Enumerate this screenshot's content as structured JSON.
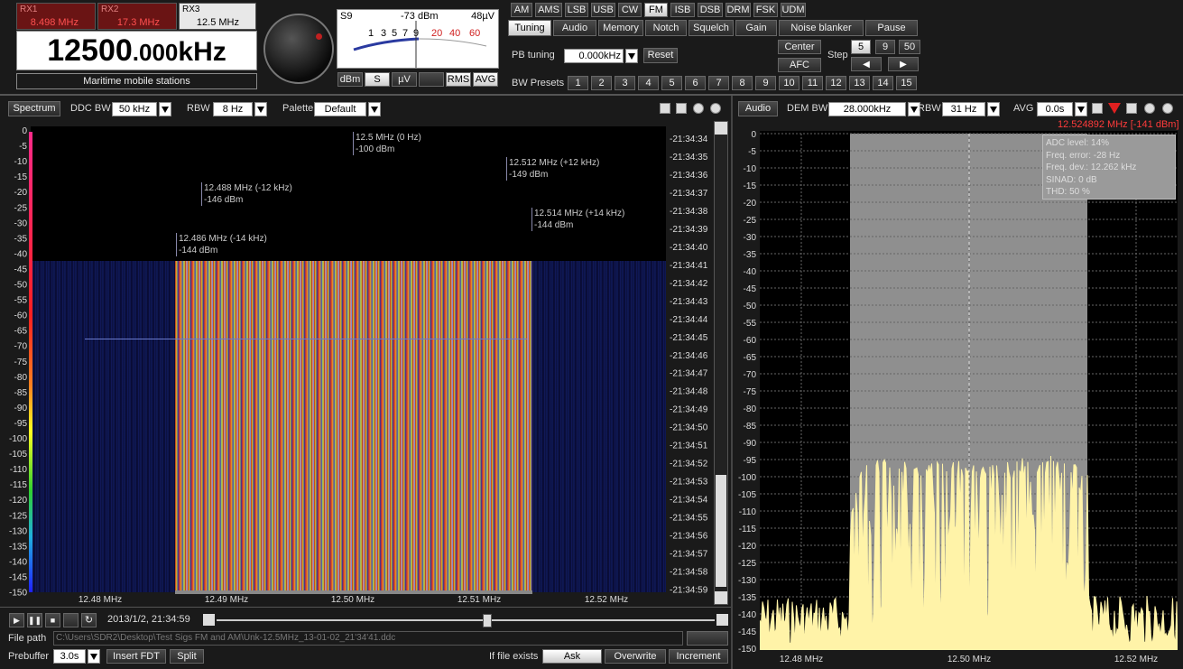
{
  "receivers": [
    {
      "name": "RX1",
      "freq": "8.498 MHz",
      "active": false
    },
    {
      "name": "RX2",
      "freq": "17.3 MHz",
      "active": false
    },
    {
      "name": "RX3",
      "freq": "12.5 MHz",
      "active": true
    }
  ],
  "main_freq": {
    "big": "12500",
    "small": ".000",
    "unit": "kHz"
  },
  "station_label": "Maritime mobile stations",
  "smeter": {
    "s_label": "S9",
    "dbm_label": "-73 dBm",
    "uv_label": "48µV",
    "scale": [
      "1",
      "3",
      "5",
      "7",
      "9",
      "20",
      "40",
      "60"
    ],
    "buttons": [
      "dBm",
      "S",
      "µV",
      "RMS",
      "AVG"
    ]
  },
  "modes": [
    "AM",
    "AMS",
    "LSB",
    "USB",
    "CW",
    "FM",
    "ISB",
    "DSB",
    "DRM",
    "FSK",
    "UDM"
  ],
  "selected_mode": "FM",
  "tabs": [
    "Tuning",
    "Audio",
    "Memory",
    "Notch",
    "Squelch",
    "Gain",
    "Noise blanker",
    "Pause"
  ],
  "tuning": {
    "pb_label": "PB tuning",
    "pb_value": "0.000kHz",
    "reset": "Reset",
    "center": "Center",
    "afc": "AFC",
    "step_label": "Step",
    "steps": [
      "5",
      "9",
      "50"
    ],
    "bw_label": "BW Presets",
    "presets": [
      "1",
      "2",
      "3",
      "4",
      "5",
      "6",
      "7",
      "8",
      "9",
      "10",
      "11",
      "12",
      "13",
      "14",
      "15"
    ]
  },
  "spectrum": {
    "title_btn": "Spectrum",
    "ddc_label": "DDC BW",
    "ddc_value": "50 kHz",
    "rbw_label": "RBW",
    "rbw_value": "8 Hz",
    "palette_label": "Palette",
    "palette_value": "Default",
    "y_ticks": [
      "0",
      "-5",
      "-10",
      "-15",
      "-20",
      "-25",
      "-30",
      "-35",
      "-40",
      "-45",
      "-50",
      "-55",
      "-60",
      "-65",
      "-70",
      "-75",
      "-80",
      "-85",
      "-90",
      "-95",
      "-100",
      "-105",
      "-110",
      "-115",
      "-120",
      "-125",
      "-130",
      "-135",
      "-140",
      "-145",
      "-150"
    ],
    "x_ticks": [
      "12.48 MHz",
      "12.49 MHz",
      "12.50 MHz",
      "12.51 MHz",
      "12.52 MHz"
    ],
    "times": [
      "-21:34:34",
      "-21:34:35",
      "-21:34:36",
      "-21:34:37",
      "-21:34:38",
      "-21:34:39",
      "-21:34:40",
      "-21:34:41",
      "-21:34:42",
      "-21:34:43",
      "-21:34:44",
      "-21:34:45",
      "-21:34:46",
      "-21:34:47",
      "-21:34:48",
      "-21:34:49",
      "-21:34:50",
      "-21:34:51",
      "-21:34:52",
      "-21:34:53",
      "-21:34:54",
      "-21:34:55",
      "-21:34:56",
      "-21:34:57",
      "-21:34:58",
      "-21:34:59"
    ],
    "markers": [
      {
        "l1": "12.5 MHz (0 Hz)",
        "l2": "-100 dBm"
      },
      {
        "l1": "12.512 MHz (+12 kHz)",
        "l2": "-149 dBm"
      },
      {
        "l1": "12.488 MHz (-12 kHz)",
        "l2": "-146 dBm"
      },
      {
        "l1": "12.514 MHz (+14 kHz)",
        "l2": "-144 dBm"
      },
      {
        "l1": "12.486 MHz (-14 kHz)",
        "l2": "-144 dBm"
      }
    ]
  },
  "audio": {
    "title_btn": "Audio",
    "dem_label": "DEM BW",
    "dem_value": "28.000kHz",
    "rbw_label": "RBW",
    "rbw_value": "31 Hz",
    "avg_label": "AVG",
    "avg_value": "0.0s",
    "readout": "12.524892 MHz [-141 dBm]",
    "stats": [
      "ADC level: 14%",
      "Freq. error: -28 Hz",
      "Freq. dev.: 12.262 kHz",
      "SINAD: 0 dB",
      "THD: 50 %"
    ],
    "y_ticks": [
      "0",
      "-5",
      "-10",
      "-15",
      "-20",
      "-25",
      "-30",
      "-35",
      "-40",
      "-45",
      "-50",
      "-55",
      "-60",
      "-65",
      "-70",
      "-75",
      "-80",
      "-85",
      "-90",
      "-95",
      "-100",
      "-105",
      "-110",
      "-115",
      "-120",
      "-125",
      "-130",
      "-135",
      "-140",
      "-145",
      "-150"
    ],
    "x_ticks": [
      "12.48 MHz",
      "12.50 MHz",
      "12.52 MHz"
    ]
  },
  "playback": {
    "datetime": "2013/1/2, 21:34:59",
    "file_label": "File path",
    "file_path": "C:\\Users\\SDR2\\Desktop\\Test Sigs FM and AM\\Unk-12.5MHz_13-01-02_21'34'41.ddc",
    "prebuffer_label": "Prebuffer",
    "prebuffer_value": "3.0s",
    "insert": "Insert FDT",
    "split": "Split",
    "if_exists": "If file exists",
    "ask": "Ask",
    "overwrite": "Overwrite",
    "increment": "Increment"
  },
  "colors": {
    "accent_red": "#ff3b3b",
    "trace": "#fff3a8",
    "passband": "#8f8f8f"
  }
}
